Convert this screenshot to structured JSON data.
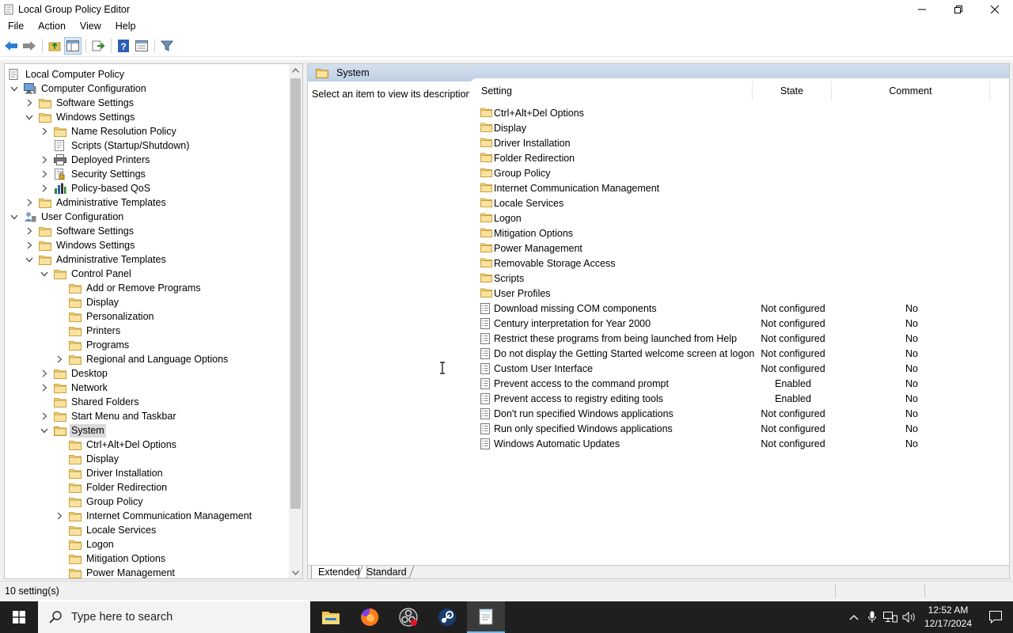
{
  "window": {
    "title": "Local Group Policy Editor"
  },
  "menu": {
    "file": "File",
    "action": "Action",
    "view": "View",
    "help": "Help"
  },
  "toolbar": [
    "back-icon",
    "forward-icon",
    "up-folder-icon",
    "show-hide-tree-icon",
    "export-list-icon",
    "help-icon",
    "properties-icon",
    "filter-icon"
  ],
  "tree": {
    "items": [
      {
        "label": "Local Computer Policy",
        "depth": 0,
        "expander": "none",
        "icon": "policy"
      },
      {
        "label": "Computer Configuration",
        "depth": 1,
        "expander": "open",
        "icon": "computer"
      },
      {
        "label": "Software Settings",
        "depth": 2,
        "expander": "closed",
        "icon": "folder"
      },
      {
        "label": "Windows Settings",
        "depth": 2,
        "expander": "open",
        "icon": "folder"
      },
      {
        "label": "Name Resolution Policy",
        "depth": 3,
        "expander": "closed",
        "icon": "folder"
      },
      {
        "label": "Scripts (Startup/Shutdown)",
        "depth": 3,
        "expander": "none",
        "icon": "script"
      },
      {
        "label": "Deployed Printers",
        "depth": 3,
        "expander": "closed",
        "icon": "printer"
      },
      {
        "label": "Security Settings",
        "depth": 3,
        "expander": "closed",
        "icon": "security"
      },
      {
        "label": "Policy-based QoS",
        "depth": 3,
        "expander": "closed",
        "icon": "chart"
      },
      {
        "label": "Administrative Templates",
        "depth": 2,
        "expander": "closed",
        "icon": "folder"
      },
      {
        "label": "User Configuration",
        "depth": 1,
        "expander": "open",
        "icon": "user"
      },
      {
        "label": "Software Settings",
        "depth": 2,
        "expander": "closed",
        "icon": "folder"
      },
      {
        "label": "Windows Settings",
        "depth": 2,
        "expander": "closed",
        "icon": "folder"
      },
      {
        "label": "Administrative Templates",
        "depth": 2,
        "expander": "open",
        "icon": "folder"
      },
      {
        "label": "Control Panel",
        "depth": 3,
        "expander": "open",
        "icon": "folder"
      },
      {
        "label": "Add or Remove Programs",
        "depth": 4,
        "expander": "none",
        "icon": "folder"
      },
      {
        "label": "Display",
        "depth": 4,
        "expander": "none",
        "icon": "folder"
      },
      {
        "label": "Personalization",
        "depth": 4,
        "expander": "none",
        "icon": "folder"
      },
      {
        "label": "Printers",
        "depth": 4,
        "expander": "none",
        "icon": "folder"
      },
      {
        "label": "Programs",
        "depth": 4,
        "expander": "none",
        "icon": "folder"
      },
      {
        "label": "Regional and Language Options",
        "depth": 4,
        "expander": "closed",
        "icon": "folder"
      },
      {
        "label": "Desktop",
        "depth": 3,
        "expander": "closed",
        "icon": "folder"
      },
      {
        "label": "Network",
        "depth": 3,
        "expander": "closed",
        "icon": "folder"
      },
      {
        "label": "Shared Folders",
        "depth": 3,
        "expander": "none",
        "icon": "folder"
      },
      {
        "label": "Start Menu and Taskbar",
        "depth": 3,
        "expander": "closed",
        "icon": "folder"
      },
      {
        "label": "System",
        "depth": 3,
        "expander": "open",
        "icon": "folder-open",
        "selected": true
      },
      {
        "label": "Ctrl+Alt+Del Options",
        "depth": 4,
        "expander": "none",
        "icon": "folder"
      },
      {
        "label": "Display",
        "depth": 4,
        "expander": "none",
        "icon": "folder"
      },
      {
        "label": "Driver Installation",
        "depth": 4,
        "expander": "none",
        "icon": "folder"
      },
      {
        "label": "Folder Redirection",
        "depth": 4,
        "expander": "none",
        "icon": "folder"
      },
      {
        "label": "Group Policy",
        "depth": 4,
        "expander": "none",
        "icon": "folder"
      },
      {
        "label": "Internet Communication Management",
        "depth": 4,
        "expander": "closed",
        "icon": "folder"
      },
      {
        "label": "Locale Services",
        "depth": 4,
        "expander": "none",
        "icon": "folder"
      },
      {
        "label": "Logon",
        "depth": 4,
        "expander": "none",
        "icon": "folder"
      },
      {
        "label": "Mitigation Options",
        "depth": 4,
        "expander": "none",
        "icon": "folder"
      },
      {
        "label": "Power Management",
        "depth": 4,
        "expander": "none",
        "icon": "folder"
      }
    ]
  },
  "right_pane": {
    "header_title": "System",
    "description": "Select an item to view its description.",
    "columns": {
      "setting": "Setting",
      "state": "State",
      "comment": "Comment"
    },
    "rows": [
      {
        "name": "Ctrl+Alt+Del Options",
        "type": "folder",
        "state": "",
        "comment": ""
      },
      {
        "name": "Display",
        "type": "folder",
        "state": "",
        "comment": ""
      },
      {
        "name": "Driver Installation",
        "type": "folder",
        "state": "",
        "comment": ""
      },
      {
        "name": "Folder Redirection",
        "type": "folder",
        "state": "",
        "comment": ""
      },
      {
        "name": "Group Policy",
        "type": "folder",
        "state": "",
        "comment": ""
      },
      {
        "name": "Internet Communication Management",
        "type": "folder",
        "state": "",
        "comment": ""
      },
      {
        "name": "Locale Services",
        "type": "folder",
        "state": "",
        "comment": ""
      },
      {
        "name": "Logon",
        "type": "folder",
        "state": "",
        "comment": ""
      },
      {
        "name": "Mitigation Options",
        "type": "folder",
        "state": "",
        "comment": ""
      },
      {
        "name": "Power Management",
        "type": "folder",
        "state": "",
        "comment": ""
      },
      {
        "name": "Removable Storage Access",
        "type": "folder",
        "state": "",
        "comment": ""
      },
      {
        "name": "Scripts",
        "type": "folder",
        "state": "",
        "comment": ""
      },
      {
        "name": "User Profiles",
        "type": "folder",
        "state": "",
        "comment": ""
      },
      {
        "name": "Download missing COM components",
        "type": "setting",
        "state": "Not configured",
        "comment": "No"
      },
      {
        "name": "Century interpretation for Year 2000",
        "type": "setting",
        "state": "Not configured",
        "comment": "No"
      },
      {
        "name": "Restrict these programs from being launched from Help",
        "type": "setting",
        "state": "Not configured",
        "comment": "No"
      },
      {
        "name": "Do not display the Getting Started welcome screen at logon",
        "type": "setting",
        "state": "Not configured",
        "comment": "No"
      },
      {
        "name": "Custom User Interface",
        "type": "setting",
        "state": "Not configured",
        "comment": "No"
      },
      {
        "name": "Prevent access to the command prompt",
        "type": "setting",
        "state": "Enabled",
        "comment": "No"
      },
      {
        "name": "Prevent access to registry editing tools",
        "type": "setting",
        "state": "Enabled",
        "comment": "No"
      },
      {
        "name": "Don't run specified Windows applications",
        "type": "setting",
        "state": "Not configured",
        "comment": "No"
      },
      {
        "name": "Run only specified Windows applications",
        "type": "setting",
        "state": "Not configured",
        "comment": "No"
      },
      {
        "name": "Windows Automatic Updates",
        "type": "setting",
        "state": "Not configured",
        "comment": "No"
      }
    ],
    "tabs": {
      "extended": "Extended",
      "standard": "Standard"
    }
  },
  "status": {
    "text": "10 setting(s)"
  },
  "taskbar": {
    "search_placeholder": "Type here to search",
    "apps": [
      "file-explorer-icon",
      "firefox-icon",
      "obs-icon",
      "steam-icon",
      "notepad-icon"
    ],
    "time": "12:52 AM",
    "date": "12/17/2024"
  },
  "colors": {
    "folder": "#e8c35a",
    "header_bar": "#c7d6e8",
    "selected": "#d9d9d9",
    "taskbar": "#1f1f1f",
    "accent": "#76b9ed"
  }
}
